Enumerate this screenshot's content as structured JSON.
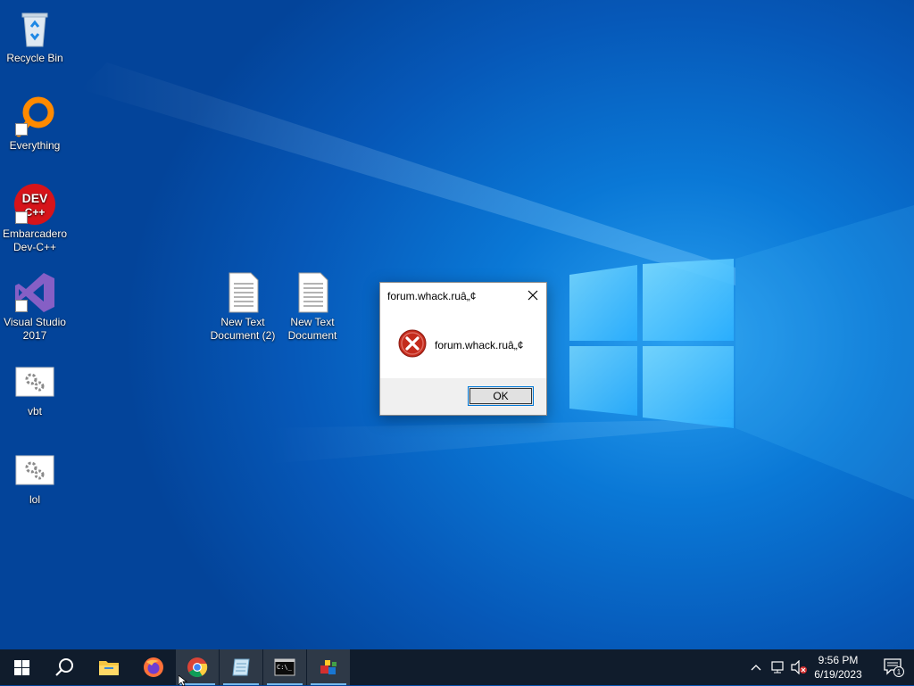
{
  "desktop_icons": [
    {
      "label": "Recycle Bin",
      "icon": "recycle-bin-icon"
    },
    {
      "label": "Everything",
      "icon": "everything-search-icon"
    },
    {
      "label": "Embarcadero\nDev-C++",
      "icon": "dev-cpp-icon"
    },
    {
      "label": "Visual Studio\n2017",
      "icon": "visual-studio-icon"
    },
    {
      "label": "vbt",
      "icon": "settings-file-icon"
    },
    {
      "label": "lol",
      "icon": "settings-file-icon"
    },
    {
      "label": "New Text\nDocument (2)",
      "icon": "text-document-icon"
    },
    {
      "label": "New Text\nDocument",
      "icon": "text-document-icon"
    }
  ],
  "dialog": {
    "title": "forum.whack.ruâ„¢",
    "message": "forum.whack.ruâ„¢",
    "ok_label": "OK",
    "icon": "error-icon"
  },
  "taskbar": {
    "pinned": [
      "start-icon",
      "search-icon",
      "file-explorer-icon",
      "firefox-icon",
      "chrome-icon",
      "notepad-icon",
      "terminal-icon",
      "app-icon"
    ],
    "active": [
      "chrome-icon",
      "notepad-icon",
      "terminal-icon",
      "app-icon"
    ]
  },
  "tray": {
    "time": "9:56 PM",
    "date": "6/19/2023",
    "notification_count": "1"
  },
  "colors": {
    "desktop_blue": "#0a78d6",
    "taskbar": "#101c2c",
    "error_red": "#c42b1c",
    "accent": "#0078d7"
  }
}
